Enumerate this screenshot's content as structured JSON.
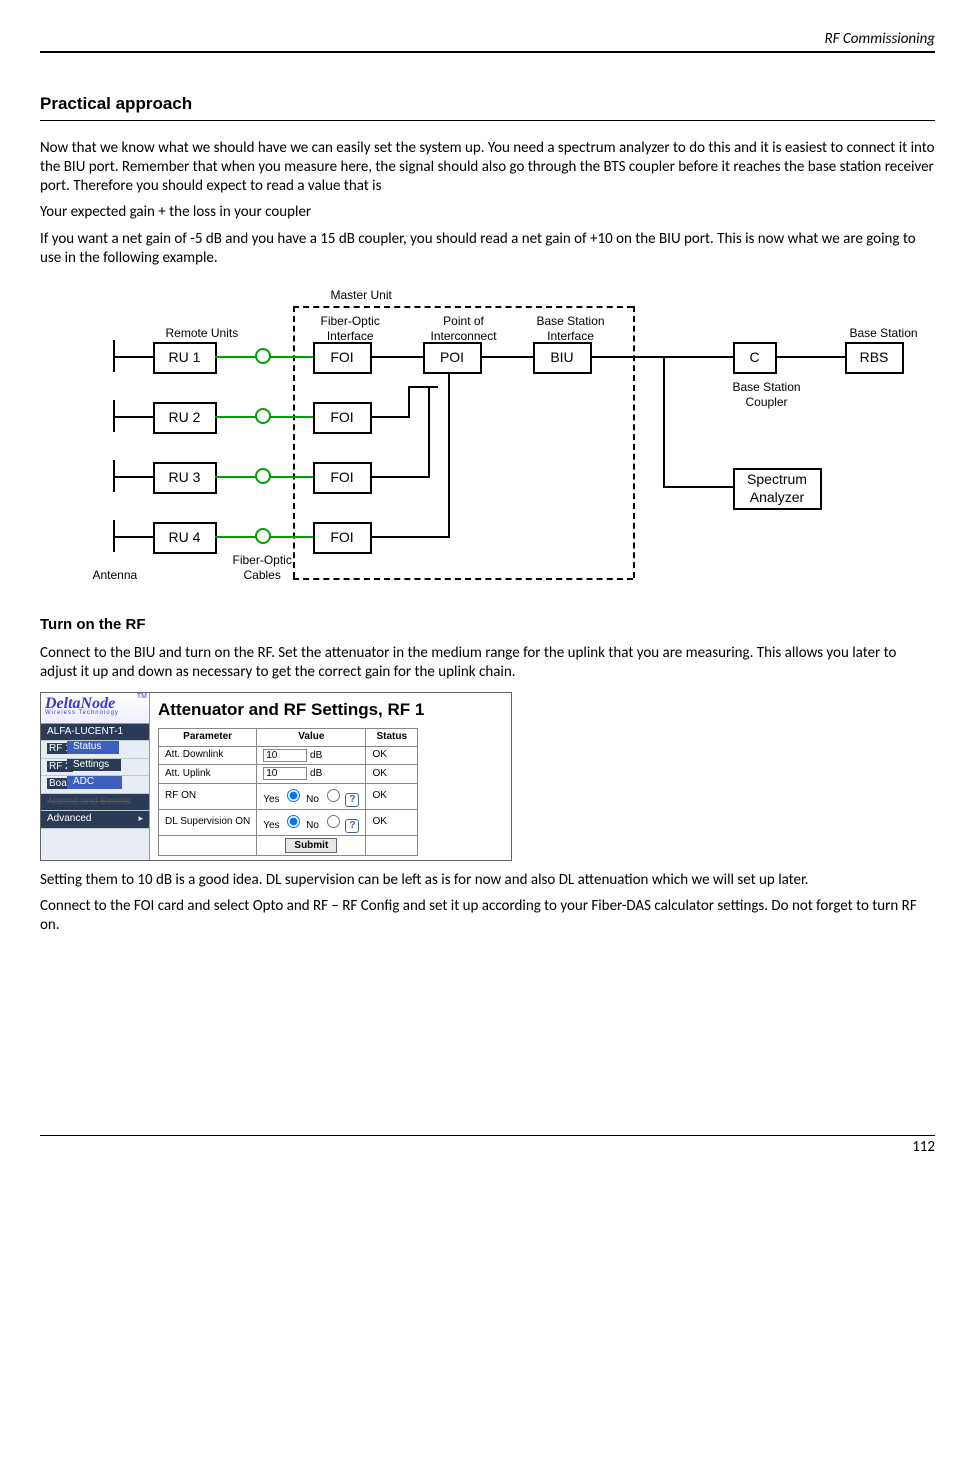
{
  "header": {
    "title": "RF Commissioning"
  },
  "section1": {
    "heading": "Practical approach",
    "p1": "Now that we know what we should have we can easily set the system up. You need a spectrum analyzer to do this and it is easiest to connect it into the BIU port. Remember that when you measure here, the signal should also go through the BTS coupler before it reaches the base station receiver port. Therefore you should expect to read a value that is",
    "p2": "Your expected gain + the loss in your coupler",
    "p3": "If you want a net gain of -5 dB and you have a 15 dB coupler, you should read a net gain of +10 on the BIU port. This is now what we are going to use in the following example."
  },
  "diagram": {
    "master_unit": "Master Unit",
    "remote_units": "Remote Units",
    "foi_label": "Fiber-Optic\nInterface",
    "poi_label": "Point of\nInterconnect",
    "biu_label": "Base Station\nInterface",
    "base_station": "Base Station",
    "bsc_label": "Base Station\nCoupler",
    "ru": [
      "RU 1",
      "RU 2",
      "RU 3",
      "RU 4"
    ],
    "foi": "FOI",
    "poi": "POI",
    "biu": "BIU",
    "c": "C",
    "rbs": "RBS",
    "sa": "Spectrum\nAnalyzer",
    "foc": "Fiber-Optic\nCables",
    "antenna": "Antenna"
  },
  "section2": {
    "heading": "Turn on the RF",
    "p1": "Connect to the BIU and turn on the RF. Set the attenuator in the medium range for the uplink that you are measuring. This allows you later to adjust it up and down as necessary to get the correct gain for the uplink chain."
  },
  "panel": {
    "brand": "DeltaNode",
    "tag": "Wireless  Technology",
    "tm": "TM",
    "nav": {
      "n0": "ALFA-LUCENT-1",
      "n1": "RF 1",
      "n2": "Status",
      "n3": "Settings",
      "n4": "RF 2",
      "n5": "ADC",
      "n6": "Boar",
      "n7": "Alarms and Events",
      "n8": "Advanced"
    },
    "title": "Attenuator and RF Settings, RF 1",
    "th": {
      "param": "Parameter",
      "value": "Value",
      "status": "Status"
    },
    "rows": {
      "r1p": "Att. Downlink",
      "r1v": "10",
      "r1u": "dB",
      "r1s": "OK",
      "r2p": "Att. Uplink",
      "r2v": "10",
      "r2u": "dB",
      "r2s": "OK",
      "r3p": "RF ON",
      "r3y": "Yes",
      "r3n": "No",
      "r3s": "OK",
      "r4p": "DL Supervision ON",
      "r4y": "Yes",
      "r4n": "No",
      "r4s": "OK"
    },
    "submit": "Submit",
    "help": "?"
  },
  "section3": {
    "p1": "Setting them to 10 dB is a good idea. DL supervision can be left as is for now and also DL attenuation which we will set up later.",
    "p2": "Connect to the FOI card and select Opto and RF – RF Config and set it up according to your Fiber-DAS calculator settings. Do not forget to turn RF on."
  },
  "footer": {
    "page": "112"
  }
}
